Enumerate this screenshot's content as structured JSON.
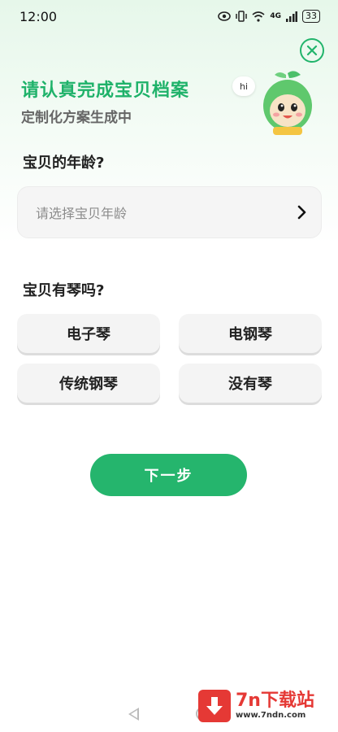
{
  "status_bar": {
    "time": "12:00",
    "signal": "4G",
    "battery": "33"
  },
  "header": {
    "title": "请认真完成宝贝档案",
    "subtitle": "定制化方案生成中",
    "mascot_bubble": "hi"
  },
  "age_section": {
    "label": "宝贝的年龄?",
    "placeholder": "请选择宝贝年龄"
  },
  "piano_section": {
    "label": "宝贝有琴吗?",
    "options": [
      "电子琴",
      "电钢琴",
      "传统钢琴",
      "没有琴"
    ]
  },
  "next_button": "下一步",
  "watermark": {
    "main": "7n下载站",
    "sub": "www.7ndn.com"
  },
  "colors": {
    "accent": "#25b56d",
    "title": "#1fb26a",
    "watermark": "#e53935"
  }
}
